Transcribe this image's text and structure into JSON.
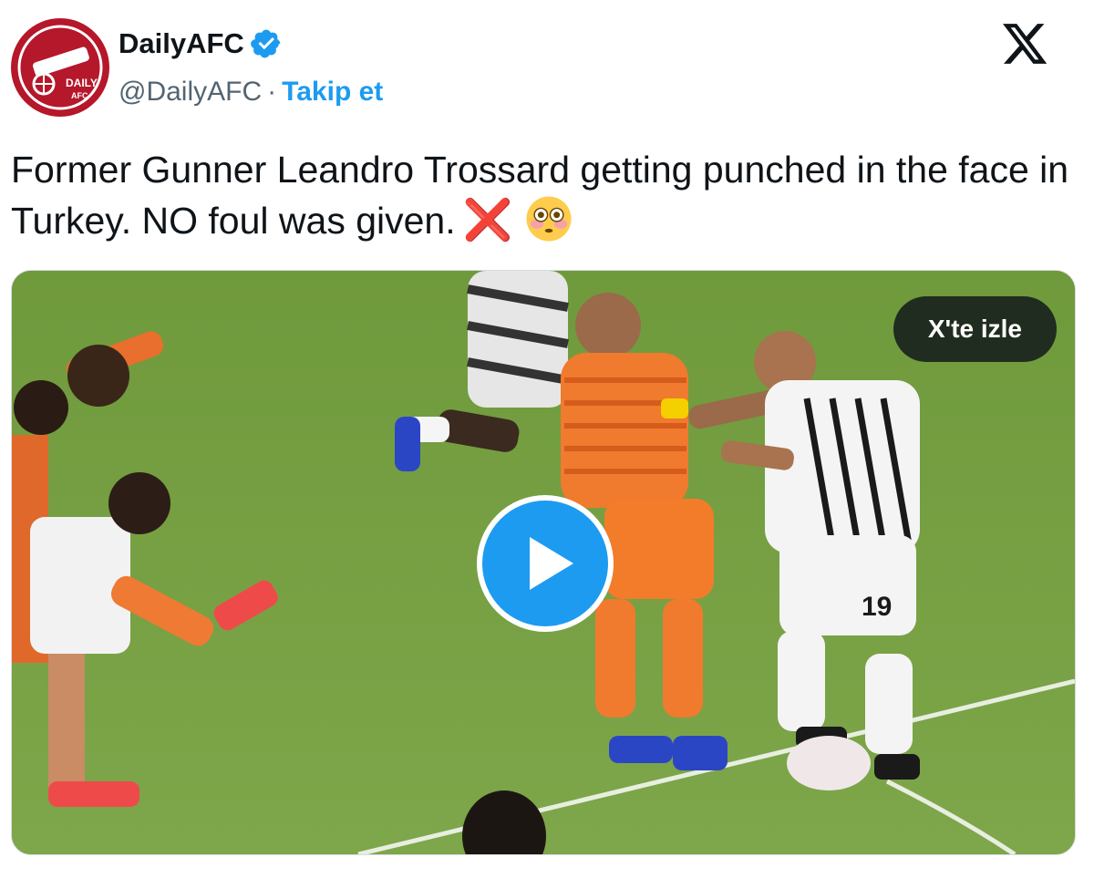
{
  "account": {
    "display_name": "DailyAFC",
    "handle": "@DailyAFC",
    "separator": "·",
    "follow_label": "Takip et",
    "avatar_text": "DAILY AFC",
    "verified_icon": "verified-badge-icon",
    "accent_color": "#1d9bf0",
    "avatar_color": "#b5172b"
  },
  "brand": {
    "logo_icon": "x-logo-icon"
  },
  "tweet": {
    "text": "Former Gunner Leandro Trossard getting punched in the face in Turkey. NO foul was given.",
    "emoji_cross": "❌",
    "emoji_face": "flushed-face-icon"
  },
  "media": {
    "watch_label": "X'te izle",
    "play_icon": "play-icon",
    "player_number": "19"
  }
}
